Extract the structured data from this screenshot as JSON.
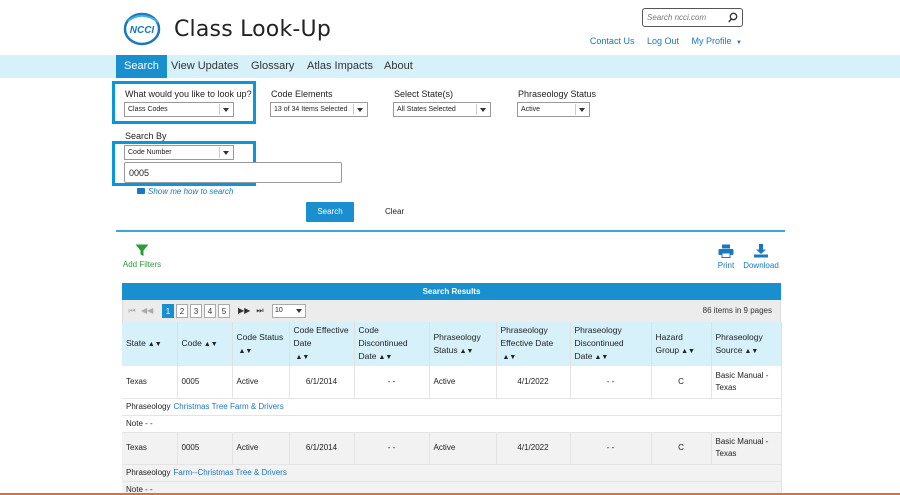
{
  "header": {
    "title": "Class Look-Up",
    "logo_text": "NCCI",
    "search_placeholder": "Search ncci.com",
    "links": [
      "Contact Us",
      "Log Out",
      "My Profile"
    ]
  },
  "nav": {
    "tabs": [
      "Search",
      "View Updates",
      "Glossary",
      "Atlas Impacts",
      "About"
    ],
    "active": "Search"
  },
  "form": {
    "lookup_label": "What would you like to look up?",
    "lookup_value": "Class Codes",
    "code_elements_label": "Code Elements",
    "code_elements_value": "13 of 34 Items Selected",
    "states_label": "Select State(s)",
    "states_value": "All States Selected",
    "phraseology_status_label": "Phraseology Status",
    "phraseology_status_value": "Active",
    "search_by_label": "Search By",
    "search_by_value": "Code Number",
    "code_input_value": "0005",
    "howto_link": "Show me how to search",
    "search_button": "Search",
    "clear_button": "Clear"
  },
  "toolbar": {
    "add_filters": "Add Filters",
    "print": "Print",
    "download": "Download"
  },
  "results": {
    "title": "Search Results",
    "pages": [
      "1",
      "2",
      "3",
      "4",
      "5"
    ],
    "current_page": "1",
    "per_page": "10",
    "items_count": "86 items in 9 pages",
    "columns": [
      {
        "label": "State",
        "sortable": true
      },
      {
        "label": "Code",
        "sortable": true
      },
      {
        "label": "Code Status",
        "sortable": true
      },
      {
        "label": "Code Effective Date",
        "sortable": true
      },
      {
        "label": "Code Discontinued Date",
        "sortable": true
      },
      {
        "label": "Phraseology Status",
        "sortable": true
      },
      {
        "label": "Phraseology Effective Date",
        "sortable": true
      },
      {
        "label": "Phraseology Discontinued Date",
        "sortable": true
      },
      {
        "label": "Hazard Group",
        "sortable": true
      },
      {
        "label": "Phraseology Source",
        "sortable": true
      }
    ],
    "rows": [
      {
        "cells": [
          "Texas",
          "0005",
          "Active",
          "6/1/2014",
          "- -",
          "Active",
          "4/1/2022",
          "- -",
          "C",
          "Basic Manual - Texas"
        ],
        "phraseology_label": "Phraseology",
        "phraseology": "Christmas Tree Farm & Drivers",
        "note_label": "Note",
        "note": "- -"
      },
      {
        "cells": [
          "Texas",
          "0005",
          "Active",
          "6/1/2014",
          "- -",
          "Active",
          "4/1/2022",
          "- -",
          "C",
          "Basic Manual - Texas"
        ],
        "phraseology_label": "Phraseology",
        "phraseology": "Farm--Christmas Tree & Drivers",
        "note_label": "Note",
        "note": "- -"
      }
    ]
  },
  "colors": {
    "accent": "#1a8fd0",
    "nav_bg": "#d6f1f9",
    "highlight": "#0a97d9",
    "filter_green": "#2a9d3a"
  },
  "icons": [
    "ncci-logo",
    "search-icon",
    "chevron-down-icon",
    "video-icon",
    "filter-icon",
    "printer-icon",
    "download-icon",
    "sort-icon"
  ]
}
